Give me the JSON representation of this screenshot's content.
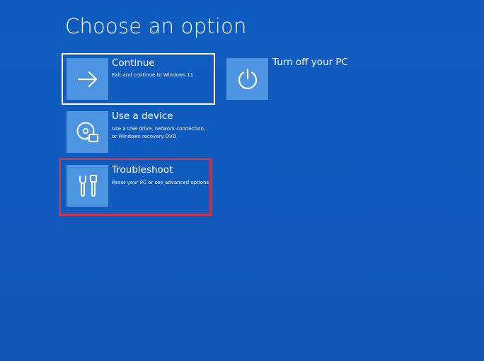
{
  "screen": {
    "title": "Choose an option"
  },
  "options": {
    "continue": {
      "title": "Continue",
      "description": "Exit and continue to Windows 11",
      "icon": "arrow-right-icon"
    },
    "use_device": {
      "title": "Use a device",
      "description_lines": [
        "Use a USB drive, network connection,",
        "or Windows recovery DVD"
      ],
      "icon": "disc-drive-icon"
    },
    "troubleshoot": {
      "title": "Troubleshoot",
      "description": "Reset your PC or see advanced options",
      "icon": "tools-icon"
    },
    "turn_off": {
      "title": "Turn off your PC",
      "icon": "power-icon"
    }
  },
  "colors": {
    "background": "#1159bb",
    "tile": "#4c93e0",
    "focus_border": "#ffffff",
    "highlight": "#c8344b"
  }
}
